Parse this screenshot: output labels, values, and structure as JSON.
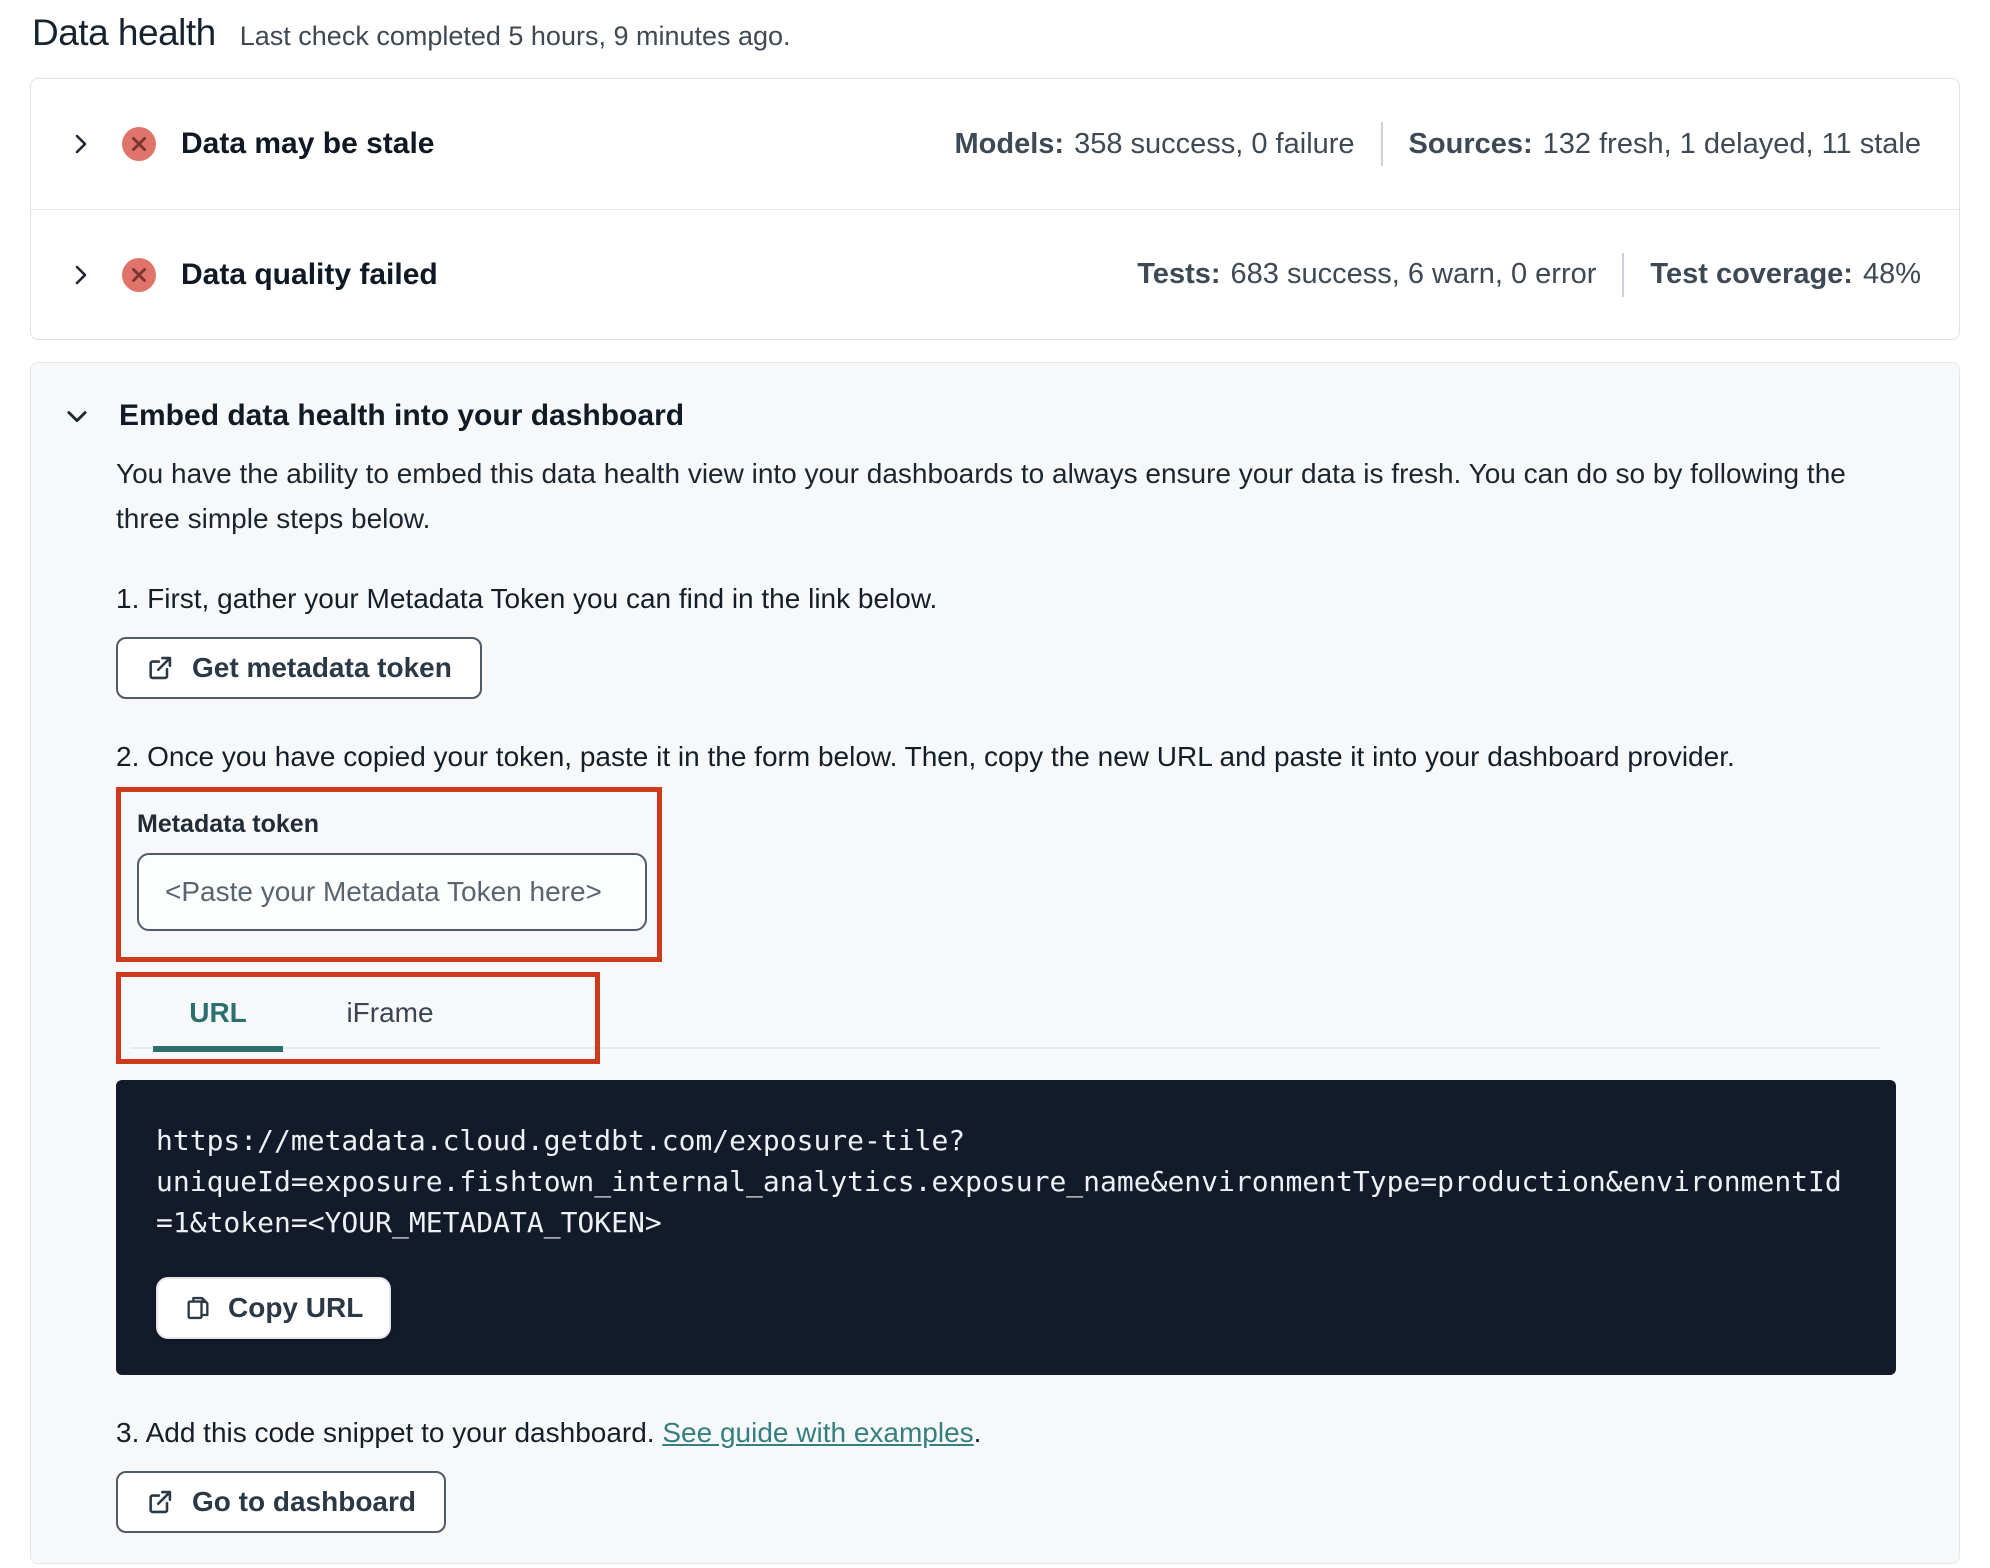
{
  "page": {
    "title": "Data health",
    "subtitle": "Last check completed 5 hours, 9 minutes ago."
  },
  "status_panels": [
    {
      "label": "Data may be stale",
      "status_icon": "error-x-circle",
      "stats": [
        {
          "label": "Models:",
          "value": "358 success, 0 failure"
        },
        {
          "label": "Sources:",
          "value": "132 fresh, 1 delayed, 11 stale"
        }
      ]
    },
    {
      "label": "Data quality failed",
      "status_icon": "error-x-circle",
      "stats": [
        {
          "label": "Tests:",
          "value": "683 success, 6 warn, 0 error"
        },
        {
          "label": "Test coverage:",
          "value": "48%"
        }
      ]
    }
  ],
  "embed": {
    "title": "Embed data health into your dashboard",
    "description": "You have the ability to embed this data health view into your dashboards to always ensure your data is fresh. You can do so by following the three simple steps below.",
    "step1": "1. First, gather your Metadata Token you can find in the link below.",
    "get_token_button": "Get metadata token",
    "step2": "2. Once you have copied your token, paste it in the form below. Then, copy the new URL and paste it into your dashboard provider.",
    "token_field": {
      "label": "Metadata token",
      "value": "",
      "placeholder": "<Paste your Metadata Token here>"
    },
    "tabs": [
      {
        "label": "URL",
        "active": true
      },
      {
        "label": "iFrame",
        "active": false
      }
    ],
    "code_url": "https://metadata.cloud.getdbt.com/exposure-tile?uniqueId=exposure.fishtown_internal_analytics.exposure_name&environmentType=production&environmentId=1&token=<YOUR_METADATA_TOKEN>",
    "copy_button": "Copy URL",
    "step3_prefix": "3. Add this code snippet to your dashboard. ",
    "step3_link": "See guide with examples",
    "step3_suffix": ".",
    "dashboard_button": "Go to dashboard"
  },
  "icons": {
    "chevron_right": "chevron-right-icon",
    "chevron_down": "chevron-down-icon",
    "error_circle": "error-x-circle-icon",
    "external_link": "external-link-icon",
    "copy": "copy-icon"
  },
  "colors": {
    "accent_teal": "#2b6f70",
    "annotation_red": "#ce3a1b",
    "error_salmon": "#e0746b",
    "error_x": "#7c3531",
    "code_background": "#131a2a",
    "card_background": "#f7f8fa"
  }
}
